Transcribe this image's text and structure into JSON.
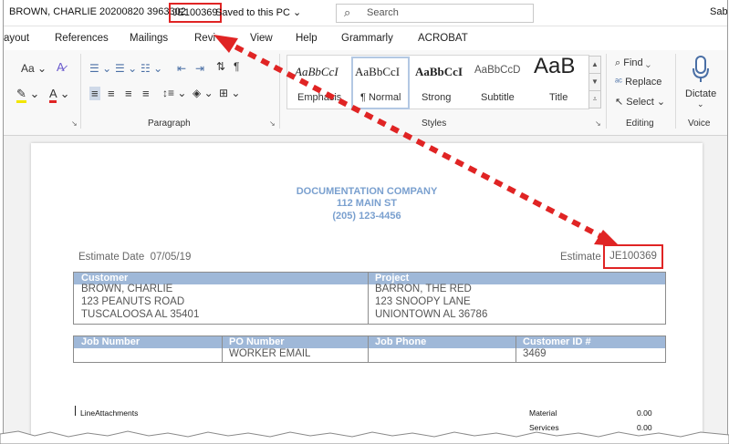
{
  "titlebar": {
    "doc_name": "BROWN, CHARLIE 20200820 3963302",
    "estimate_id": "JE100369",
    "saved_status": "Saved to this PC",
    "search_placeholder": "Search",
    "user": "Sab"
  },
  "tabs": [
    "ayout",
    "References",
    "Mailings",
    "Revi",
    "View",
    "Help",
    "Grammarly",
    "ACROBAT"
  ],
  "ribbon": {
    "font_size_label": "Aa",
    "groups": {
      "paragraph": "Paragraph",
      "styles": "Styles",
      "editing": "Editing",
      "voice": "Voice"
    },
    "styles": [
      {
        "sample": "AaBbCcI",
        "name": "Emphasis"
      },
      {
        "sample": "AaBbCcI",
        "name": "¶ Normal"
      },
      {
        "sample": "AaBbCcI",
        "name": "Strong"
      },
      {
        "sample": "AaBbCcD",
        "name": "Subtitle"
      },
      {
        "sample": "AaB",
        "name": "Title"
      }
    ],
    "editing": {
      "find": "Find",
      "replace": "Replace",
      "select": "Select"
    },
    "dictate": "Dictate"
  },
  "document": {
    "company": {
      "name": "DOCUMENTATION COMPANY",
      "address": "112 MAIN ST",
      "phone": "(205) 123-4456"
    },
    "estimate_date_label": "Estimate Date",
    "estimate_date": "07/05/19",
    "estimate_label": "Estimate",
    "estimate_number": "JE100369",
    "customer_table": {
      "headers": [
        "Customer",
        "Project"
      ],
      "customer": [
        "BROWN, CHARLIE",
        "123 PEANUTS ROAD",
        "TUSCALOOSA  AL  35401"
      ],
      "project": [
        "BARRON, THE RED",
        "123 SNOOPY LANE",
        "UNIONTOWN  AL  36786"
      ]
    },
    "job_table": {
      "headers": [
        "Job Number",
        "PO Number",
        "Job Phone",
        "Customer ID #"
      ],
      "row": [
        "",
        "WORKER EMAIL",
        "",
        "3469"
      ]
    },
    "line_attachments": "LineAttachments",
    "totals": [
      {
        "label": "Material",
        "value": "0.00"
      },
      {
        "label": "Services",
        "value": "0.00"
      }
    ]
  },
  "colors": {
    "accent_red": "#e02424",
    "header_blue": "#9fb8d8",
    "company_blue": "#7aa0cf"
  }
}
